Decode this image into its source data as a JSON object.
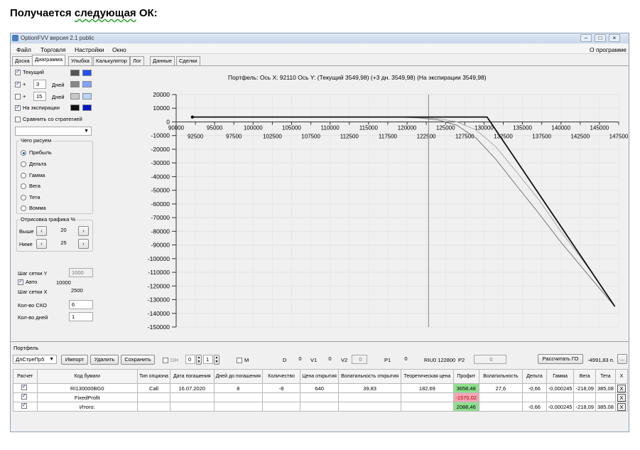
{
  "heading": {
    "before": "Получается ",
    "squiggle": "следующая",
    "after": " ОК:"
  },
  "window": {
    "title": "OptionFVV версия 2.1 public"
  },
  "menu": {
    "items": [
      "Файл",
      "Торговля",
      "Настройки",
      "Окно"
    ],
    "about": "О программе"
  },
  "tabs": [
    {
      "label": "Доска",
      "active": false
    },
    {
      "label": "Диаграмма",
      "active": true
    },
    {
      "label": "Улыбка",
      "active": false
    },
    {
      "label": "Калькулятор",
      "active": false
    },
    {
      "label": "Лог",
      "active": false
    },
    {
      "label": "Данные",
      "active": false
    },
    {
      "label": "Сделки",
      "active": false
    }
  ],
  "left": {
    "current_label": "Текущий",
    "plus": "+",
    "days_label": "Дней",
    "plus_days_1": "3",
    "plus_days_2": "15",
    "expiry_label": "На экспирации",
    "compare_label": "Сравнить со стратегией",
    "draw_group": "Чего рисуем",
    "draw_options": [
      "Прибыль",
      "Дельта",
      "Гамма",
      "Вега",
      "Тета",
      "Вомма"
    ],
    "render_group": "Отрисовка графика %",
    "above_label": "Выше",
    "above_value": "20",
    "below_label": "Ниже",
    "below_value": "25",
    "grid_y_label": "Шаг сетки Y",
    "grid_y_value": "1000",
    "auto_label": "Авто",
    "auto_value": "10000",
    "grid_x_label": "Шаг сетки X",
    "grid_x_value": "2500",
    "sko_label": "Кол-во СКО",
    "sko_value": "6",
    "days_count_label": "Кол-во дней",
    "days_count_value": "1",
    "colors": {
      "current": [
        "#555555",
        "#1f4fff"
      ],
      "plus1": [
        "#888888",
        "#7fa4ff"
      ],
      "plus2": [
        "#c8c8c8",
        "#b8d4ff"
      ],
      "expiry": [
        "#111111",
        "#0018c8"
      ]
    }
  },
  "chart_data": {
    "type": "line",
    "title": "Портфель: Ось X: 92110 Ось Y:  (Текущий 3549,98)  (+3 дн. 3549,98)  (На экспирации 3549,98)",
    "xlim": [
      90000,
      147500
    ],
    "ylim": [
      -150000,
      20000
    ],
    "y_ticks": [
      20000,
      10000,
      0,
      -10000,
      -20000,
      -30000,
      -40000,
      -50000,
      -60000,
      -70000,
      -80000,
      -90000,
      -100000,
      -110000,
      -120000,
      -130000,
      -140000,
      -150000
    ],
    "x_ticks_upper": [
      90000,
      95000,
      100000,
      105000,
      110000,
      115000,
      120000,
      125000,
      130000,
      135000,
      140000,
      145000
    ],
    "x_ticks_lower": [
      92500,
      97500,
      102500,
      107500,
      112500,
      117500,
      122500,
      127500,
      132500,
      137500,
      142500,
      147500
    ],
    "cursor_x": 122800,
    "start_point": [
      92110,
      3550
    ],
    "series": [
      {
        "color": "#111111",
        "points": [
          [
            92110,
            3550
          ],
          [
            130400,
            3550
          ],
          [
            147000,
            -135000
          ]
        ]
      },
      {
        "color": "#777777",
        "points": [
          [
            92110,
            3550
          ],
          [
            119000,
            3500
          ],
          [
            121500,
            3000
          ],
          [
            124000,
            1500
          ],
          [
            126500,
            -2500
          ],
          [
            129000,
            -12000
          ],
          [
            131500,
            -27000
          ],
          [
            134000,
            -45000
          ],
          [
            137000,
            -66000
          ],
          [
            140000,
            -88000
          ],
          [
            144000,
            -115000
          ],
          [
            147000,
            -135000
          ]
        ]
      },
      {
        "color": "#aaaaaa",
        "points": [
          [
            92110,
            3550
          ],
          [
            121000,
            3500
          ],
          [
            124000,
            2500
          ],
          [
            126500,
            0
          ],
          [
            129000,
            -6000
          ],
          [
            131500,
            -18000
          ],
          [
            134000,
            -35000
          ],
          [
            137000,
            -56000
          ],
          [
            140000,
            -80000
          ],
          [
            144000,
            -110000
          ],
          [
            147000,
            -135000
          ]
        ]
      }
    ]
  },
  "portfolio": {
    "label": "Портфель",
    "selector": "ДлСтреПр5",
    "import": "Импорт",
    "delete": "Удалить",
    "save": "Сохранить",
    "dh": "DH",
    "dh_val1": "0",
    "dh_val2": "1",
    "m": "M",
    "d_label": "D",
    "d_val": "0",
    "v1_label": "V1",
    "v1_val": "0",
    "v2_label": "V2",
    "v2_val": "0",
    "p1_label": "P1",
    "p1_val": "0",
    "riu": "RIU0 122800",
    "p2_label": "P2",
    "p2_val": "0",
    "calc_go": "Рассчитать ГО",
    "go_value": "-4991,83 п.",
    "more": "..."
  },
  "table": {
    "headers": [
      "Расчет",
      "Код бумаги",
      "Тип опциона",
      "Дата погашения",
      "Дней до погашения",
      "Количество",
      "Цена открытия",
      "Волатильность открытия",
      "Теоретическая цена",
      "Профит",
      "Волатильность",
      "Дельта",
      "Гамма",
      "Вега",
      "Тета",
      "X"
    ],
    "rows": [
      [
        "RI130000BG0",
        "Call",
        "16.07.2020",
        "8",
        "-8",
        "640",
        "39,83",
        "182,69",
        "3658,48",
        "27,6",
        "-0,66",
        "-0,000245",
        "-218,09",
        "385,08"
      ],
      [
        "FixedProfit",
        "",
        "",
        "",
        "",
        "",
        "",
        "",
        "-1570,02",
        "",
        "",
        "",
        "",
        ""
      ],
      [
        "Итого:",
        "",
        "",
        "",
        "",
        "",
        "",
        "",
        "2088,46",
        "",
        "-0,66",
        "-0,000245",
        "-218,09",
        "385,08"
      ]
    ],
    "x_label": "X"
  }
}
